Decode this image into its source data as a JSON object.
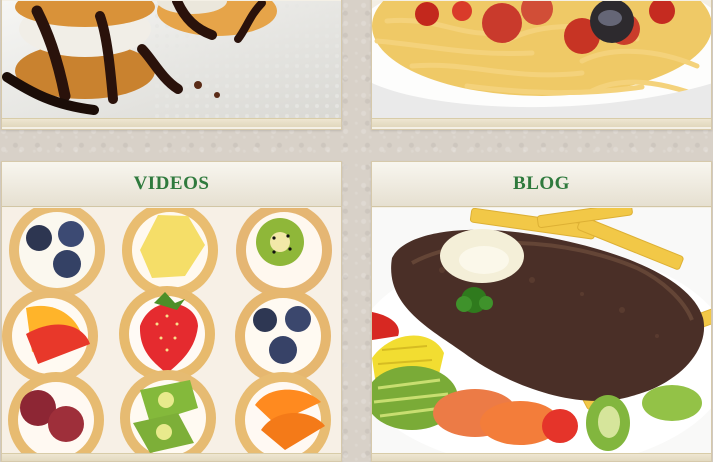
{
  "sections": [
    {
      "title": "VIDEOS",
      "image": "fruit-tarts-image"
    },
    {
      "title": "BLOG",
      "image": "steak-fries-image"
    }
  ],
  "top_cards": [
    {
      "image": "cream-puffs-chocolate-image"
    },
    {
      "image": "spaghetti-image"
    }
  ],
  "colors": {
    "title_text": "#2f7a3d",
    "card_bg": "#f4f0e6",
    "background": "#d8d1c8"
  }
}
